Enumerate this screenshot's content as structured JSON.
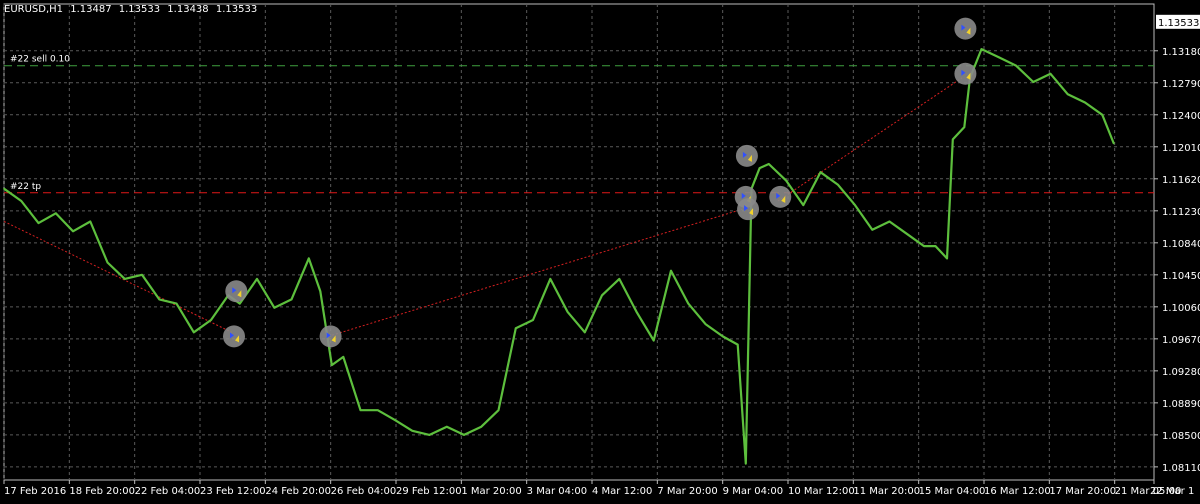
{
  "header": {
    "symbol": "EURUSD,H1",
    "open": "1.13487",
    "high": "1.13533",
    "low": "1.13438",
    "close": "1.13533"
  },
  "colors": {
    "background": "#000000",
    "grid": "#5a5a5a",
    "axis_text": "#ffffff",
    "bars": "#5dbf3d",
    "sell_line": "#3f9f3f",
    "tp_line": "#e01818",
    "trend_line": "#d62020",
    "marker_bg": "#8a8a8a",
    "price_label_bg": "#ffffff",
    "price_label_fg": "#000000"
  },
  "chart_data": {
    "type": "line",
    "title": "EURUSD,H1",
    "ylim": [
      1.0795,
      1.1375
    ],
    "y_ticks": [
      "1.13180",
      "1.12790",
      "1.12400",
      "1.12010",
      "1.11620",
      "1.11230",
      "1.10840",
      "1.10450",
      "1.10060",
      "1.09670",
      "1.09280",
      "1.08890",
      "1.08500",
      "1.08110"
    ],
    "current_price_label": "1.13533",
    "x_ticks": [
      "17 Feb 2016",
      "18 Feb 20:00",
      "22 Feb 04:00",
      "23 Feb 12:00",
      "24 Feb 20:00",
      "26 Feb 04:00",
      "29 Feb 12:00",
      "1 Mar 20:00",
      "3 Mar 04:00",
      "4 Mar 12:00",
      "7 Mar 20:00",
      "9 Mar 04:00",
      "10 Mar 12:00",
      "11 Mar 20:00",
      "15 Mar 04:00",
      "16 Mar 12:00",
      "17 Mar 20:00",
      "21 Mar 05:00",
      "22 Mar 1"
    ],
    "x_range": [
      0,
      100
    ],
    "series": [
      {
        "x": [
          0,
          1.5,
          3,
          4.5,
          6,
          7.5,
          9,
          10.5,
          12,
          13.5,
          15,
          16.5,
          18,
          19.5,
          20.5,
          22,
          23.5,
          25,
          26.5,
          27.5,
          28.5,
          29.5,
          31,
          32.5,
          34,
          35.5,
          37,
          38.5,
          40,
          41.5,
          43,
          44.5,
          46,
          47.5,
          49,
          50.5,
          52,
          53.5,
          55,
          56.5,
          58,
          59.5,
          61,
          62.5,
          63.8,
          64.5,
          65,
          65.7,
          66.5,
          68,
          69.5,
          71,
          72.5,
          74,
          75.5,
          77,
          78.5,
          80,
          81,
          82,
          82.5,
          83.5,
          84,
          85,
          86.5,
          88,
          89.5,
          91,
          92.5,
          94,
          95.5,
          96.5
        ],
        "y": [
          1.115,
          1.1135,
          1.1108,
          1.112,
          1.1098,
          1.111,
          1.106,
          1.104,
          1.1045,
          1.1015,
          1.101,
          1.0975,
          1.099,
          1.102,
          1.101,
          1.104,
          1.1005,
          1.1015,
          1.1065,
          1.1025,
          1.0935,
          1.0945,
          1.088,
          1.088,
          1.0868,
          1.0855,
          1.085,
          1.086,
          1.085,
          1.086,
          1.088,
          1.098,
          1.099,
          1.104,
          1.1,
          1.0975,
          1.102,
          1.104,
          1.1,
          1.0965,
          1.105,
          1.101,
          1.0985,
          1.097,
          1.096,
          1.0815,
          1.115,
          1.1175,
          1.118,
          1.116,
          1.113,
          1.117,
          1.1155,
          1.113,
          1.11,
          1.111,
          1.1095,
          1.108,
          1.108,
          1.1065,
          1.121,
          1.1225,
          1.1285,
          1.132,
          1.131,
          1.13,
          1.128,
          1.129,
          1.1265,
          1.1255,
          1.124,
          1.1205
        ]
      }
    ],
    "hlines": [
      {
        "label": "#22 sell 0.10",
        "value": 1.12998,
        "style": "dash-green"
      },
      {
        "label": "#22 tp",
        "value": 1.1145,
        "style": "dash-red"
      }
    ],
    "trend_lines": [
      {
        "from": [
          0,
          1.111
        ],
        "to": [
          19.8,
          1.0975
        ]
      },
      {
        "from": [
          28.2,
          1.097
        ],
        "to": [
          64.2,
          1.1125
        ]
      },
      {
        "from": [
          67.3,
          1.1135
        ],
        "to": [
          83.3,
          1.1285
        ]
      }
    ],
    "trade_markers": [
      {
        "x": 20.2,
        "y": 1.1025
      },
      {
        "x": 20.0,
        "y": 1.097
      },
      {
        "x": 28.4,
        "y": 1.097
      },
      {
        "x": 64.6,
        "y": 1.119
      },
      {
        "x": 64.5,
        "y": 1.114
      },
      {
        "x": 64.7,
        "y": 1.1125
      },
      {
        "x": 67.5,
        "y": 1.114
      },
      {
        "x": 83.6,
        "y": 1.1345
      },
      {
        "x": 83.6,
        "y": 1.129
      }
    ]
  }
}
